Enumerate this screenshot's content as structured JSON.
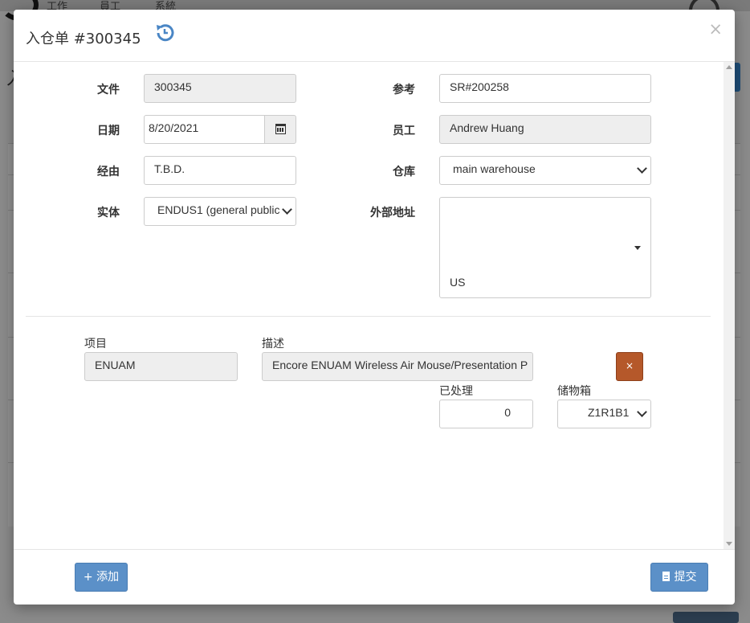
{
  "background": {
    "menu": [
      "工作",
      "員工",
      "系統"
    ]
  },
  "modal": {
    "title": "入仓单 #300345",
    "close_symbol": "×",
    "history_icon": "history-icon",
    "form": {
      "file": {
        "label": "文件",
        "value": "300345"
      },
      "reference": {
        "label": "参考",
        "value": "SR#200258"
      },
      "date": {
        "label": "日期",
        "value": "8/20/2021"
      },
      "employee": {
        "label": "员工",
        "value": "Andrew Huang"
      },
      "via": {
        "label": "经由",
        "value": "T.B.D."
      },
      "warehouse": {
        "label": "仓库",
        "value": "main warehouse"
      },
      "entity": {
        "label": "实体",
        "value": "ENDUS1 (general public"
      },
      "external_address": {
        "label": "外部地址",
        "value": "US"
      }
    },
    "line_item": {
      "item_label": "项目",
      "item_value": "ENUAM",
      "desc_label": "描述",
      "desc_value": "Encore ENUAM Wireless Air Mouse/Presentation P",
      "processed_label": "已处理",
      "processed_value": "0",
      "bin_label": "储物箱",
      "bin_value": "Z1R1B1",
      "delete_symbol": "×"
    },
    "footer": {
      "add_label": "+ 添加",
      "submit_label": "提交"
    }
  },
  "colors": {
    "primary": "#5b90c8",
    "danger": "#b5582a",
    "backdrop": "#8b8b8b"
  }
}
